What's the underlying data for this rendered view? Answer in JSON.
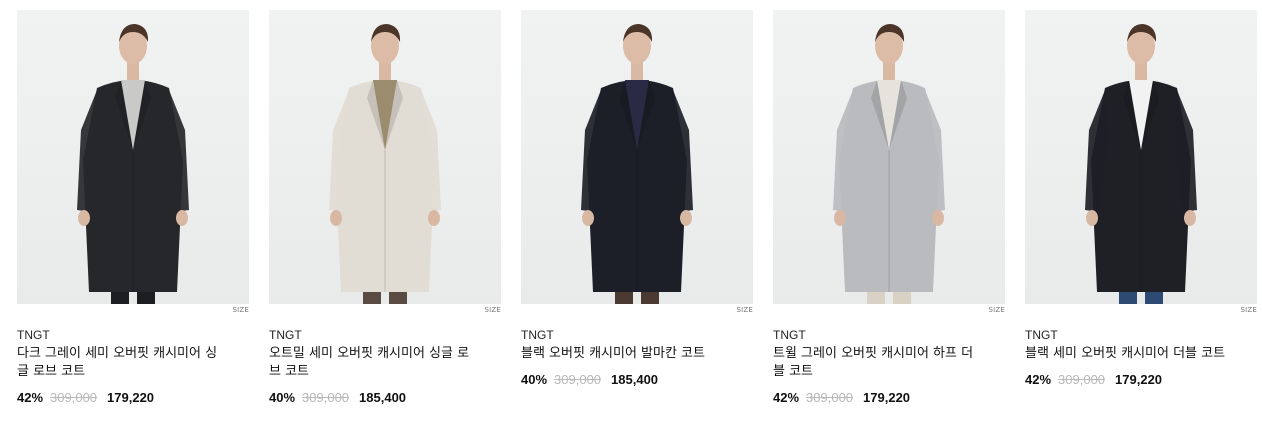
{
  "products": [
    {
      "brand": "TNGT",
      "name": "다크 그레이 세미 오버핏 캐시미어 싱글 로브 코트",
      "discount": "42%",
      "original_price": "309,000",
      "sale_price": "179,220",
      "size_label": "SIZE",
      "coat_color": "#25272b",
      "inner_color": "#c9c9c7",
      "pants_color": "#1d1e22"
    },
    {
      "brand": "TNGT",
      "name": "오트밀 세미 오버핏 캐시미어 싱글 로브 코트",
      "discount": "40%",
      "original_price": "309,000",
      "sale_price": "185,400",
      "size_label": "SIZE",
      "coat_color": "#e1dcd4",
      "inner_color": "#9c8c6e",
      "pants_color": "#5a4c42"
    },
    {
      "brand": "TNGT",
      "name": "블랙 오버핏 캐시미어 발마칸 코트",
      "discount": "40%",
      "original_price": "309,000",
      "sale_price": "185,400",
      "size_label": "SIZE",
      "coat_color": "#1c1f27",
      "inner_color": "#2a2a44",
      "pants_color": "#4a3a32"
    },
    {
      "brand": "TNGT",
      "name": "트윌 그레이 오버핏 캐시미어 하프 더블 코트",
      "discount": "42%",
      "original_price": "309,000",
      "sale_price": "179,220",
      "size_label": "SIZE",
      "coat_color": "#b9bbbe",
      "inner_color": "#e6e3dc",
      "pants_color": "#d9d2c4"
    },
    {
      "brand": "TNGT",
      "name": "블랙 세미 오버핏 캐시미어 더블 코트",
      "discount": "42%",
      "original_price": "309,000",
      "sale_price": "179,220",
      "size_label": "SIZE",
      "coat_color": "#1e2026",
      "inner_color": "#f2f2f2",
      "pants_color": "#2c4a72"
    }
  ]
}
